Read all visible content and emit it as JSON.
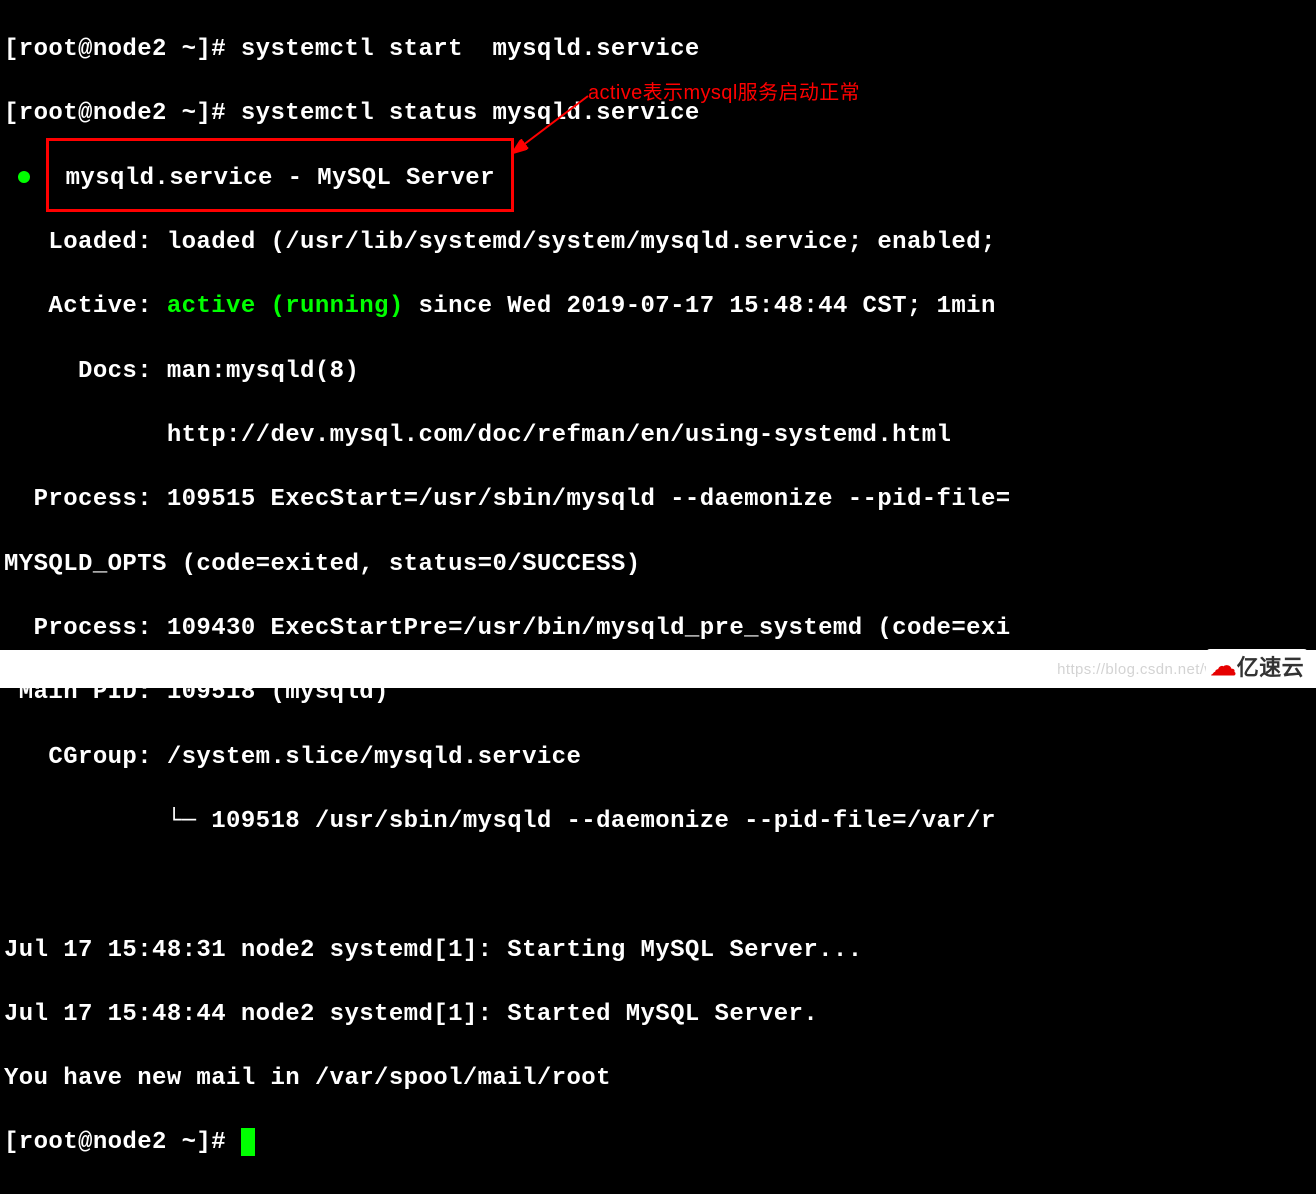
{
  "prompt": "[root@node2 ~]# ",
  "cmd1": "systemctl start  mysqld.service",
  "cmd2": "systemctl status mysqld.service",
  "unit_header": "  mysqld.service - MySQL Server",
  "loaded": "   Loaded: loaded (/usr/lib/systemd/system/mysqld.service; enabled;",
  "active_label": "   Active: ",
  "active_value": "active (running)",
  "active_rest": " since Wed 2019-07-17 15:48:44 CST; 1min ",
  "docs1": "     Docs: man:mysqld(8)",
  "docs2": "           http://dev.mysql.com/doc/refman/en/using-systemd.html",
  "process1": "  Process: 109515 ExecStart=/usr/sbin/mysqld --daemonize --pid-file=",
  "process1b": "MYSQLD_OPTS (code=exited, status=0/SUCCESS)",
  "process2": "  Process: 109430 ExecStartPre=/usr/bin/mysqld_pre_systemd (code=exi",
  "mainpid": " Main PID: 109518 (mysqld)",
  "cgroup": "   CGroup: /system.slice/mysqld.service",
  "cgroup_child": "           └─ 109518 /usr/sbin/mysqld --daemonize --pid-file=/var/r",
  "blank": " ",
  "log1": "Jul 17 15:48:31 node2 systemd[1]: Starting MySQL Server...",
  "log2": "Jul 17 15:48:44 node2 systemd[1]: Started MySQL Server.",
  "mail": "You have new mail in /var/spool/mail/root",
  "annotation": "active表示mysql服务启动正常",
  "watermark": "https://blog.csdn.net/weix",
  "logo_text": "亿速云"
}
